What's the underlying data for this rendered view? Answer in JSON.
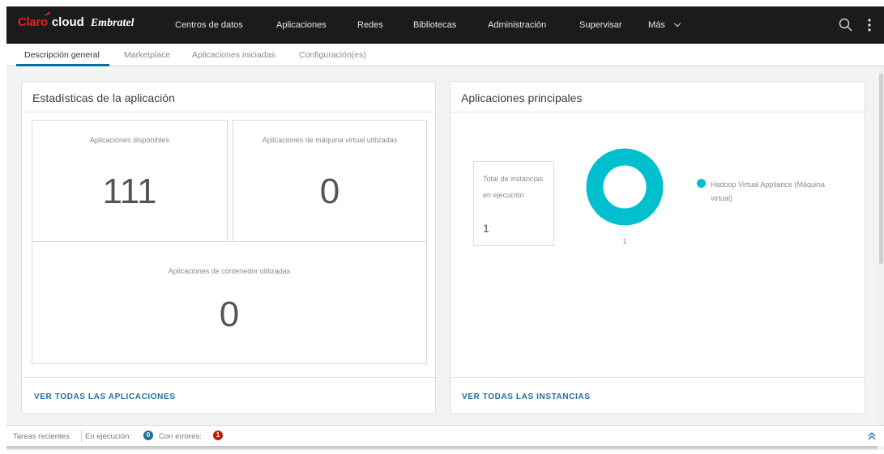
{
  "header": {
    "logo": {
      "claro": "Claro",
      "cloud": "cloud",
      "embratel": "Embratel"
    },
    "nav": [
      "Centros de datos",
      "Aplicaciones",
      "Redes",
      "Bibliotecas",
      "Administración",
      "Supervisar",
      "Más"
    ],
    "icons": {
      "search": "search-icon",
      "menu": "kebab-icon"
    }
  },
  "tabs": [
    {
      "label": "Descripción general",
      "active": true
    },
    {
      "label": "Marketplace",
      "active": false
    },
    {
      "label": "Aplicaciones iniciadas",
      "active": false
    },
    {
      "label": "Configuración(es)",
      "active": false
    }
  ],
  "stats_card": {
    "title": "Estadísticas de la aplicación",
    "stats": [
      {
        "label": "Aplicaciones disponibles",
        "value": "111"
      },
      {
        "label": "Aplicaciones de máquina virtual utilizadas",
        "value": "0"
      },
      {
        "label": "Aplicaciones de contenedor utilizadas",
        "value": "0"
      }
    ],
    "link": "VER TODAS LAS APLICACIONES"
  },
  "top_apps_card": {
    "title": "Aplicaciones principales",
    "total_label": "Total de instancias en ejecución",
    "total_value": "1",
    "donut_label": "1",
    "legend": [
      {
        "name": "Hadoop Virtual Appliance (Máquina virtual)",
        "value": 1,
        "color": "#00c0d0"
      }
    ],
    "link": "VER TODAS LAS INSTANCIAS"
  },
  "footer": {
    "recent_tasks": "Tareas recientes",
    "running_label": "En ejecución:",
    "running_count": "0",
    "running_color": "#1f6f9c",
    "errors_label": "Con errores:",
    "errors_count": "1",
    "errors_color": "#c21d00",
    "expand_icon": "chevron-double-up-icon"
  },
  "colors": {
    "header_bg": "#1b1b1b",
    "accent": "#0072a3",
    "brand_red": "#e2231a"
  }
}
